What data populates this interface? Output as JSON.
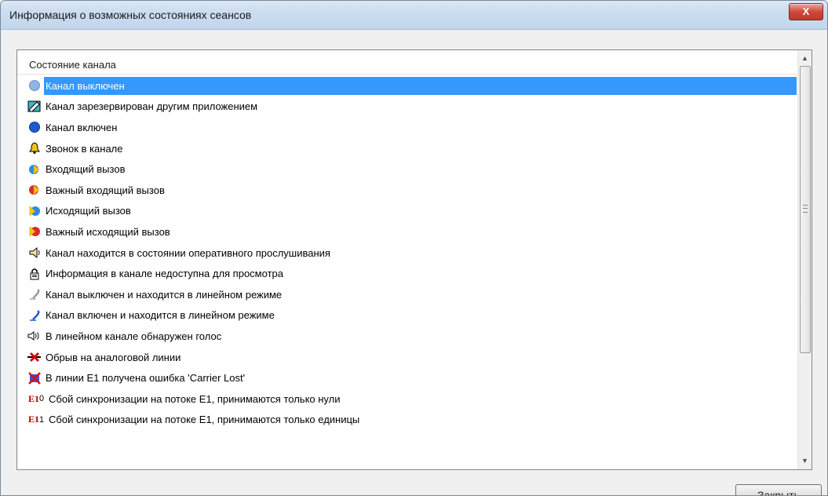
{
  "window": {
    "title": "Информация о возможных состояниях сеансов",
    "close_glyph": "X"
  },
  "list": {
    "header": "Состояние канала",
    "items": [
      {
        "label": "Канал выключен",
        "icon": "channel-off-icon"
      },
      {
        "label": "Канал зарезервирован другим приложением",
        "icon": "channel-reserved-icon"
      },
      {
        "label": "Канал включен",
        "icon": "channel-on-icon"
      },
      {
        "label": "Звонок в канале",
        "icon": "bell-icon"
      },
      {
        "label": "Входящий вызов",
        "icon": "incoming-call-icon"
      },
      {
        "label": "Важный входящий вызов",
        "icon": "important-incoming-call-icon"
      },
      {
        "label": "Исходящий вызов",
        "icon": "outgoing-call-icon"
      },
      {
        "label": "Важный исходящий вызов",
        "icon": "important-outgoing-call-icon"
      },
      {
        "label": "Канал находится в состоянии оперативного прослушивания",
        "icon": "speaker-icon"
      },
      {
        "label": "Информация в канале недоступна для просмотра",
        "icon": "lock-icon"
      },
      {
        "label": "Канал выключен и находится в линейном режиме",
        "icon": "line-mode-off-icon"
      },
      {
        "label": "Канал включен и находится в линейном режиме",
        "icon": "line-mode-on-icon"
      },
      {
        "label": "В линейном канале обнаружен голос",
        "icon": "voice-detected-icon"
      },
      {
        "label": "Обрыв на аналоговой линии",
        "icon": "line-break-icon"
      },
      {
        "label": "В линии E1 получена ошибка 'Carrier Lost'",
        "icon": "carrier-lost-icon"
      },
      {
        "label": "Сбой синхронизации на потоке E1, принимаются только нули",
        "icon": "e1-zeros-icon",
        "icon_text": "E1",
        "icon_sup": "0"
      },
      {
        "label": "Сбой синхронизации на потоке E1, принимаются только единицы",
        "icon": "e1-ones-icon",
        "icon_text": "E1",
        "icon_sup": "1"
      }
    ],
    "selected_index": 0
  },
  "buttons": {
    "close_label": "Закрыть"
  },
  "scrollbar": {
    "up_glyph": "▲",
    "down_glyph": "▼"
  }
}
